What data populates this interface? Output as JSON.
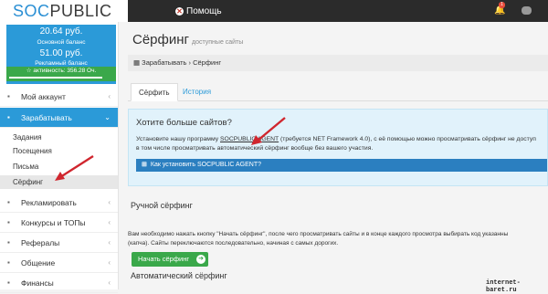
{
  "topbar": {
    "logo_soc": "SOC",
    "logo_public": "PUBLIC",
    "help_label": "Помощь",
    "notifications_count": "1"
  },
  "balance": {
    "main_value": "20.64 руб.",
    "main_label": "Основной баланс",
    "ad_value": "51.00 руб.",
    "ad_label": "Рекламный баланс",
    "activity": "активность: 356.28 Оч.",
    "activity_progress_pct": 85
  },
  "nav": {
    "my_account": "Мой аккаунт",
    "earn": "Зарабатывать",
    "sub": [
      "Задания",
      "Посещения",
      "Письма",
      "Сёрфинг"
    ],
    "advertise": "Рекламировать",
    "contests": "Конкурсы и ТОПы",
    "referrals": "Рефералы",
    "communication": "Общение",
    "finance": "Финансы"
  },
  "page": {
    "title": "Сёрфинг",
    "subtitle": "доступные сайты",
    "breadcrumb_root": "Зарабатывать",
    "breadcrumb_current": "Сёрфинг"
  },
  "tabs": [
    "Сёрфить",
    "История"
  ],
  "info": {
    "heading": "Хотите больше сайтов?",
    "line1_pre": "Установите нашу программу",
    "line1_link": "SOCPUBLIC AGENT",
    "line1_post": "(требуется NET Framework 4.0), с её помощью можно просматривать сёрфинг не доступ",
    "line2": "в том числе просматривать автоматический сёрфинг вообще без вашего участия.",
    "howto_label": "Как установить SOCPUBLIC AGENT?"
  },
  "manual": {
    "title": "Ручной сёрфинг",
    "desc_line1": "Вам необходимо нажать кнопку \"Начать сёрфинг\", после чего просматривать сайты и в конце каждого просмотра выбирать код указанны",
    "desc_line2": "(капча). Сайты переключаются последовательно, начиная с самых дорогих.",
    "start_button": "Начать сёрфинг"
  },
  "auto": {
    "title": "Автоматический сёрфинг"
  },
  "watermark": "internet-baret.ru",
  "colors": {
    "accent_blue": "#2b9ad8",
    "green": "#3aa84a",
    "arrow_red": "#d0262e"
  }
}
